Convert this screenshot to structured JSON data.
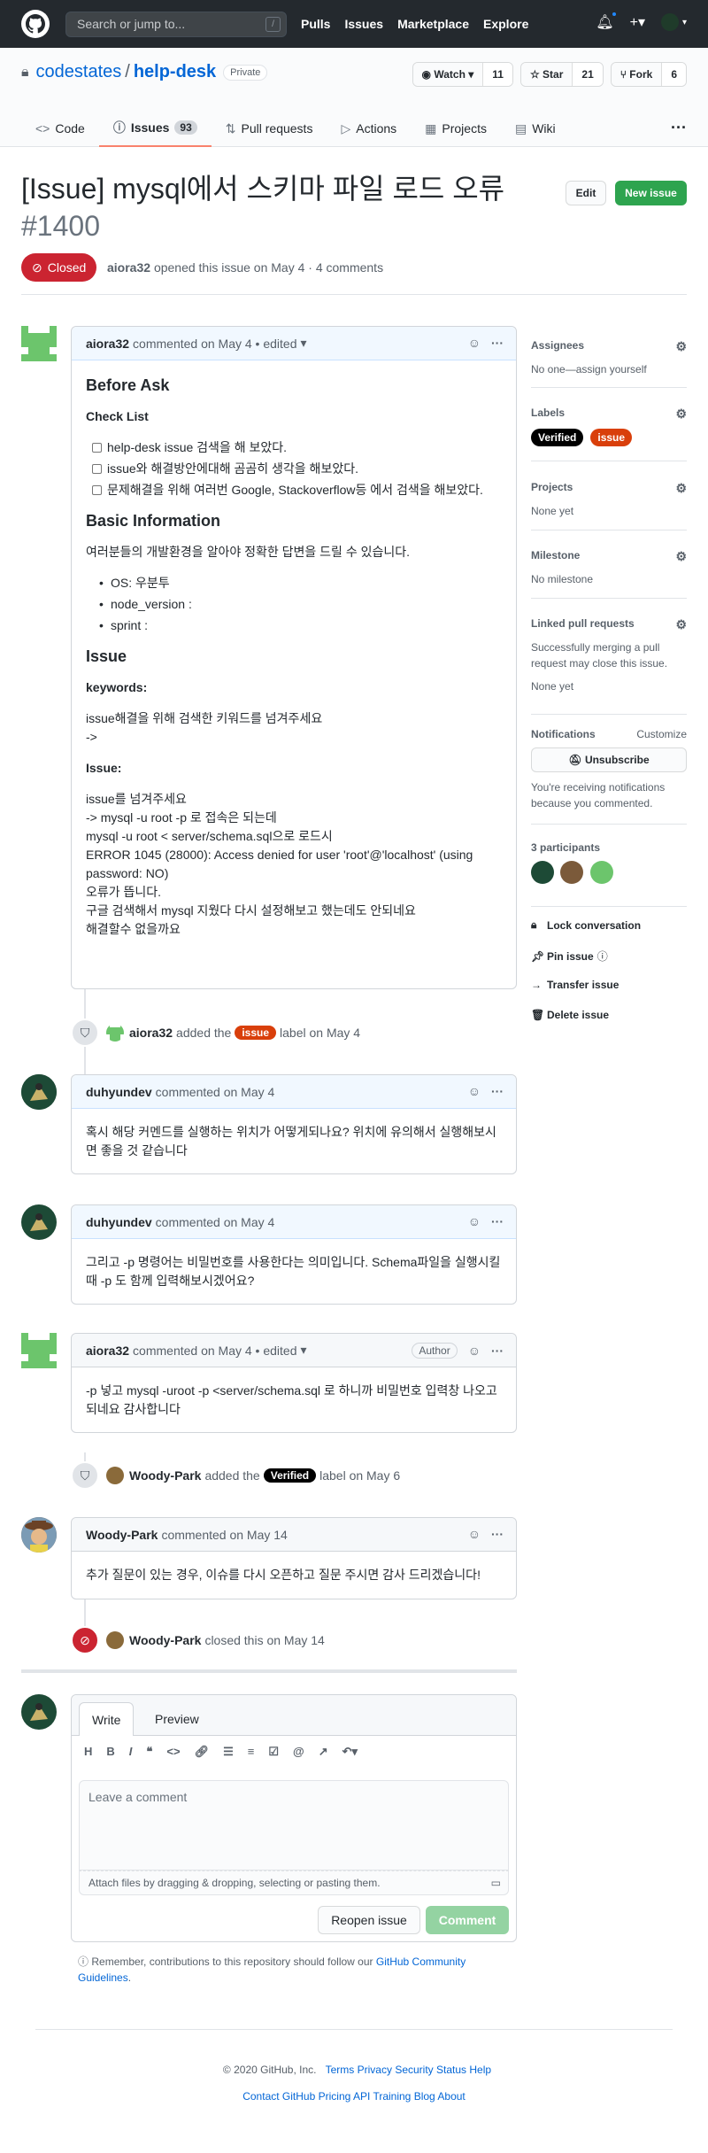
{
  "header": {
    "search_placeholder": "Search or jump to...",
    "search_key": "/",
    "nav": [
      "Pulls",
      "Issues",
      "Marketplace",
      "Explore"
    ]
  },
  "repo": {
    "owner": "codestates",
    "separator": "/",
    "name": "help-desk",
    "visibility": "Private",
    "watch_label": "Watch",
    "watch_count": "11",
    "star_label": "Star",
    "star_count": "21",
    "fork_label": "Fork",
    "fork_count": "6",
    "tabs": [
      {
        "label": "Code"
      },
      {
        "label": "Issues",
        "count": "93"
      },
      {
        "label": "Pull requests"
      },
      {
        "label": "Actions"
      },
      {
        "label": "Projects"
      },
      {
        "label": "Wiki"
      }
    ]
  },
  "issue": {
    "title": "[Issue] mysql에서 스키마 파일 로드 오류",
    "number": "#1400",
    "edit_label": "Edit",
    "new_issue_label": "New issue",
    "state": "Closed",
    "author": "aiora32",
    "meta_text": "opened this issue on May 4 · 4 comments"
  },
  "first_comment": {
    "author": "aiora32",
    "meta": "commented on May 4 • edited",
    "h_before": "Before Ask",
    "h_check": "Check List",
    "checks": [
      "help-desk issue 검색을 해 보았다.",
      "issue와 해결방안에대해 곰곰히 생각을 해보았다.",
      "문제해결을 위해 여러번 Google, Stackoverflow등 에서 검색을 해보았다."
    ],
    "h_basic": "Basic Information",
    "basic_text": "여러분들의 개발환경을 알아야 정확한 답변을 드릴 수 있습니다.",
    "env": [
      "OS: 우분투",
      "node_version :",
      "sprint :"
    ],
    "h_issue": "Issue",
    "h_keywords": "keywords:",
    "kw_line1": "issue해결을 위해 검색한 키워드를 넘겨주세요",
    "kw_line2": "->",
    "h_issue2": "Issue:",
    "issue_lines": [
      "issue를 넘겨주세요",
      "-> mysql -u root -p 로 접속은 되는데",
      "mysql -u root < server/schema.sql으로 로드시",
      "ERROR 1045 (28000): Access denied for user 'root'@'localhost' (using password: NO)",
      "오류가 뜹니다.",
      "구글 검색해서 mysql 지웠다 다시 설정해보고 했는데도 안되네요",
      "해결할수 없을까요"
    ]
  },
  "event1": {
    "user": "aiora32",
    "pre": "added the",
    "label": "issue",
    "post": "label on May 4"
  },
  "comment2": {
    "author": "duhyundev",
    "meta": "commented on May 4",
    "body": "혹시 해당 커멘드를 실행하는 위치가 어떻게되나요? 위치에 유의해서 실행해보시면 좋을 것 같습니다"
  },
  "comment3": {
    "author": "duhyundev",
    "meta": "commented on May 4",
    "body": "그리고 -p 명령어는 비밀번호를 사용한다는 의미입니다. Schema파일을 실행시킬때 -p 도 함께 입력해보시겠어요?"
  },
  "comment4": {
    "author": "aiora32",
    "meta": "commented on May 4 • edited",
    "badge": "Author",
    "body": "-p 넣고 mysql -uroot -p <server/schema.sql 로 하니까 비밀번호 입력창 나오고 되네요 감사합니다"
  },
  "event2": {
    "user": "Woody-Park",
    "pre": "added the",
    "label": "Verified",
    "post": "label on May 6"
  },
  "comment5": {
    "author": "Woody-Park",
    "meta": "commented on May 14",
    "body": "추가 질문이 있는 경우, 이슈를 다시 오픈하고 질문 주시면 감사 드리겠습니다!"
  },
  "event3": {
    "user": "Woody-Park",
    "text": "closed this on May 14"
  },
  "composer": {
    "tab_write": "Write",
    "tab_preview": "Preview",
    "placeholder": "Leave a comment",
    "attach": "Attach files by dragging & dropping, selecting or pasting them.",
    "reopen": "Reopen issue",
    "submit": "Comment",
    "remember_pre": "Remember, contributions to this repository should follow our",
    "remember_link": "GitHub Community Guidelines",
    "remember_post": "."
  },
  "sidebar": {
    "assignees_title": "Assignees",
    "assignees_value": "No one—assign yourself",
    "labels_title": "Labels",
    "labels": [
      {
        "name": "Verified",
        "color": "#000000"
      },
      {
        "name": "issue",
        "color": "#d93f0b"
      }
    ],
    "projects_title": "Projects",
    "projects_value": "None yet",
    "milestone_title": "Milestone",
    "milestone_value": "No milestone",
    "linked_title": "Linked pull requests",
    "linked_text": "Successfully merging a pull request may close this issue.",
    "linked_value": "None yet",
    "notif_title": "Notifications",
    "notif_customize": "Customize",
    "unsubscribe": "Unsubscribe",
    "notif_text": "You're receiving notifications because you commented.",
    "participants_title": "3 participants",
    "lock": "Lock conversation",
    "pin": "Pin issue",
    "transfer": "Transfer issue",
    "delete": "Delete issue"
  },
  "footer": {
    "copyright": "© 2020 GitHub, Inc.",
    "row1": [
      "Terms",
      "Privacy",
      "Security",
      "Status",
      "Help"
    ],
    "row2": [
      "Contact GitHub",
      "Pricing",
      "API",
      "Training",
      "Blog",
      "About"
    ]
  },
  "colors": {
    "closed": "#cb2431",
    "label_issue": "#d93f0b",
    "label_verified": "#000000",
    "accent": "#0366d6"
  }
}
